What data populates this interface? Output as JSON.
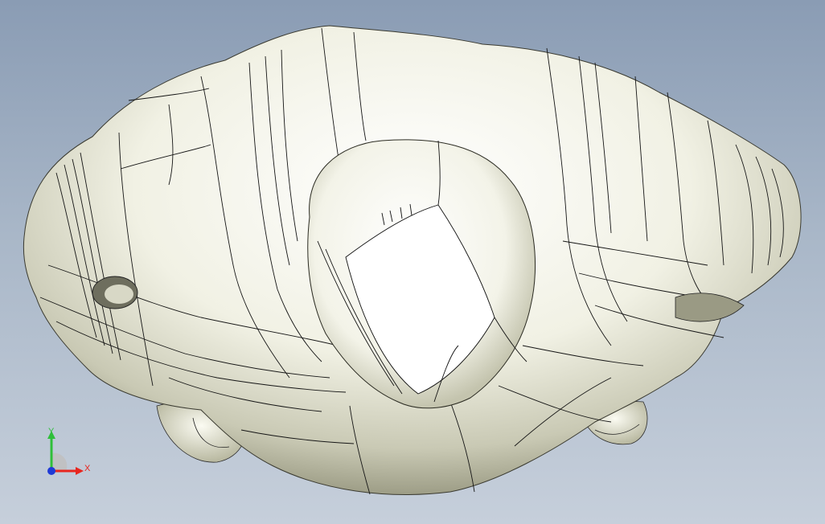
{
  "viewport": {
    "background_top": "#8a9cb4",
    "background_bottom": "#c6cfdb",
    "model_color": "#f2f2e6",
    "edge_color": "#111111"
  },
  "triad": {
    "x_label": "X",
    "y_label": "Y",
    "x_color": "#e8261f",
    "y_color": "#2fbf3a",
    "z_color": "#1f3ad6"
  }
}
